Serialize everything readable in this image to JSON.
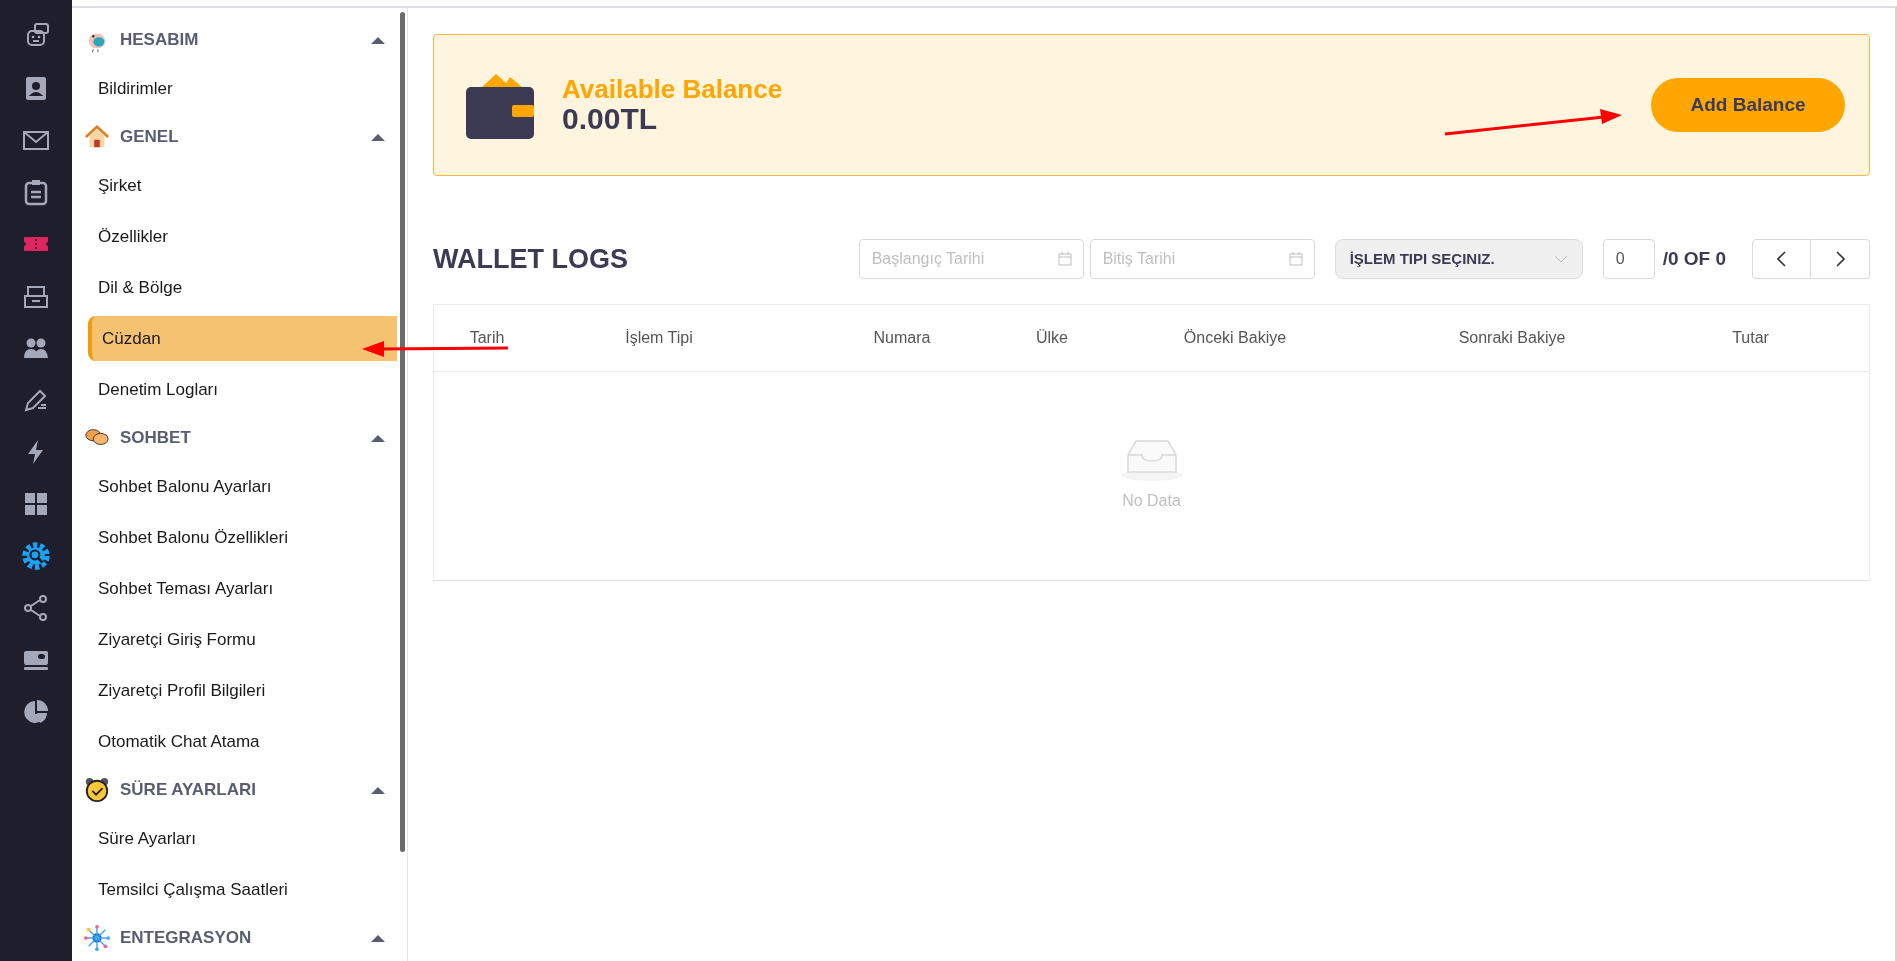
{
  "rail": [
    {
      "kind": "robot",
      "color": "#a5a8b8",
      "selected": false
    },
    {
      "kind": "contact",
      "color": "#a5a8b8",
      "selected": false
    },
    {
      "kind": "mail",
      "color": "#a5a8b8",
      "selected": false
    },
    {
      "kind": "clipboard",
      "color": "#a5a8b8",
      "selected": false
    },
    {
      "kind": "ticket",
      "color": "#e0245e",
      "selected": false
    },
    {
      "kind": "inbox",
      "color": "#a5a8b8",
      "selected": false
    },
    {
      "kind": "people",
      "color": "#a5a8b8",
      "selected": false
    },
    {
      "kind": "pen",
      "color": "#a5a8b8",
      "selected": false
    },
    {
      "kind": "bolt",
      "color": "#a5a8b8",
      "selected": false
    },
    {
      "kind": "grid",
      "color": "#a5a8b8",
      "selected": false
    },
    {
      "kind": "gear",
      "color": "#1da1f2",
      "selected": true
    },
    {
      "kind": "share",
      "color": "#a5a8b8",
      "selected": false
    },
    {
      "kind": "card",
      "color": "#a5a8b8",
      "selected": false
    },
    {
      "kind": "pie",
      "color": "#a5a8b8",
      "selected": false
    }
  ],
  "sidebar": {
    "sections": [
      {
        "title": "HESABIM",
        "kind": "bird",
        "expanded": true,
        "items": [
          {
            "label": "Bildirimler",
            "selected": false
          }
        ]
      },
      {
        "title": "GENEL",
        "kind": "house",
        "expanded": true,
        "items": [
          {
            "label": "Şirket",
            "selected": false
          },
          {
            "label": "Özellikler",
            "selected": false
          },
          {
            "label": "Dil & Bölge",
            "selected": false
          },
          {
            "label": "Cüzdan",
            "selected": true
          },
          {
            "label": "Denetim Logları",
            "selected": false
          }
        ]
      },
      {
        "title": "SOHBET",
        "kind": "chat",
        "expanded": true,
        "items": [
          {
            "label": "Sohbet Balonu Ayarları",
            "selected": false
          },
          {
            "label": "Sohbet Balonu Özellikleri",
            "selected": false
          },
          {
            "label": "Sohbet Teması Ayarları",
            "selected": false
          },
          {
            "label": "Ziyaretçi Giriş Formu",
            "selected": false
          },
          {
            "label": "Ziyaretçi Profil Bilgileri",
            "selected": false
          },
          {
            "label": "Otomatik Chat Atama",
            "selected": false
          }
        ]
      },
      {
        "title": "SÜRE AYARLARI",
        "kind": "clock",
        "expanded": true,
        "items": [
          {
            "label": "Süre Ayarları",
            "selected": false
          },
          {
            "label": "Temsilci Çalışma Saatleri",
            "selected": false
          }
        ]
      },
      {
        "title": "ENTEGRASYON",
        "kind": "network",
        "expanded": true
      }
    ]
  },
  "balance": {
    "title": "Available Balance",
    "amount": "0.00TL",
    "button": "Add Balance"
  },
  "wallet_logs": {
    "title": "WALLET LOGS",
    "start_date": {
      "placeholder": "Başlangıç Tarihi"
    },
    "end_date": {
      "placeholder": "Bitiş Tarihi"
    },
    "type_select": {
      "placeholder": "İŞLEM TIPI SEÇINIZ."
    },
    "page_input": {
      "value": "0"
    },
    "page_total": "/0 OF 0",
    "columns": [
      "Tarih",
      "İşlem Tipi",
      "Numara",
      "Ülke",
      "Önceki Bakiye",
      "Sonraki Bakiye",
      "Tutar"
    ],
    "empty_text": "No Data"
  }
}
